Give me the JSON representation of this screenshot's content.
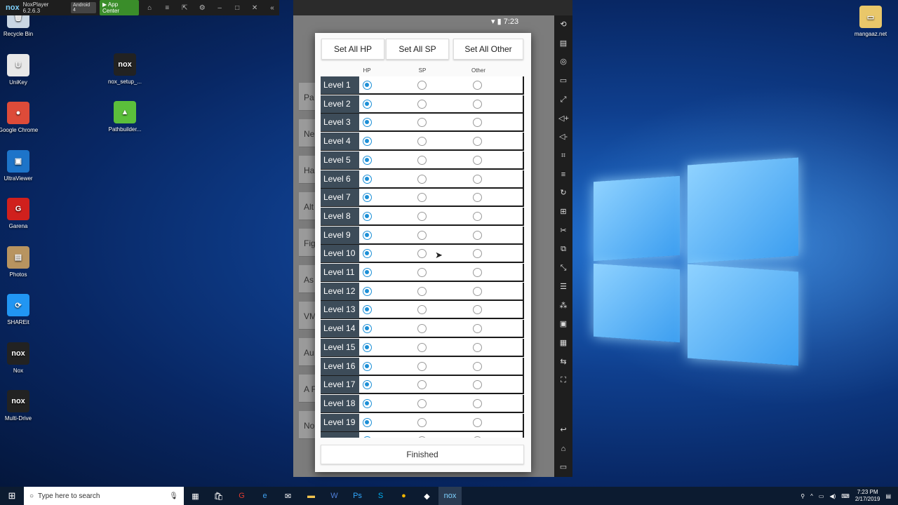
{
  "desktop": {
    "icons": [
      {
        "label": "Recycle Bin",
        "icon": "recycle-bin-icon",
        "color": "#c9d6e3",
        "glyph": "🗑"
      },
      {
        "label": "UniKey",
        "icon": "unikey-icon",
        "color": "#e8e8e8",
        "glyph": "U"
      },
      {
        "label": "Google Chrome",
        "icon": "chrome-icon",
        "color": "#dd4b39",
        "glyph": "●"
      },
      {
        "label": "UltraViewer",
        "icon": "ultraviewer-icon",
        "color": "#1d74c9",
        "glyph": "▣"
      },
      {
        "label": "Garena",
        "icon": "garena-icon",
        "color": "#d0201d",
        "glyph": "G"
      },
      {
        "label": "Photos",
        "icon": "photos-icon",
        "color": "#b89460",
        "glyph": "▤"
      },
      {
        "label": "SHAREit",
        "icon": "shareit-icon",
        "color": "#2196f3",
        "glyph": "⟳"
      },
      {
        "label": "Nox",
        "icon": "nox-icon",
        "color": "#222",
        "glyph": "nox"
      },
      {
        "label": "Multi-Drive",
        "icon": "multi-drive-icon",
        "color": "#222",
        "glyph": "nox"
      }
    ],
    "icons2": [
      {
        "label": "nox_setup_...",
        "icon": "nox-setup-icon",
        "color": "#222",
        "glyph": "nox"
      },
      {
        "label": "Pathbuilder...",
        "icon": "pathbuilder-icon",
        "color": "#5bbf3b",
        "glyph": "▲"
      }
    ],
    "folder": {
      "label": "mangaaz.net",
      "icon": "folder-icon"
    }
  },
  "nox": {
    "title": "NoxPlayer 6.2.6.3",
    "logo": "nox",
    "android": "Android 4",
    "app_center": "App Center",
    "time": "7:23"
  },
  "dialog": {
    "btn_hp": "Set All HP",
    "btn_sp": "Set All SP",
    "btn_other": "Set All Other",
    "col_hp": "HP",
    "col_sp": "SP",
    "col_other": "Other",
    "finish": "Finished",
    "accent": "#1c8fd6",
    "levels": [
      {
        "label": "Level 1",
        "selected": "HP"
      },
      {
        "label": "Level 2",
        "selected": "HP"
      },
      {
        "label": "Level 3",
        "selected": "HP"
      },
      {
        "label": "Level 4",
        "selected": "HP"
      },
      {
        "label": "Level 5",
        "selected": "HP"
      },
      {
        "label": "Level 6",
        "selected": "HP"
      },
      {
        "label": "Level 7",
        "selected": "HP"
      },
      {
        "label": "Level 8",
        "selected": "HP"
      },
      {
        "label": "Level 9",
        "selected": "HP"
      },
      {
        "label": "Level 10",
        "selected": "HP"
      },
      {
        "label": "Level 11",
        "selected": "HP"
      },
      {
        "label": "Level 12",
        "selected": "HP"
      },
      {
        "label": "Level 13",
        "selected": "HP"
      },
      {
        "label": "Level 14",
        "selected": "HP"
      },
      {
        "label": "Level 15",
        "selected": "HP"
      },
      {
        "label": "Level 16",
        "selected": "HP"
      },
      {
        "label": "Level 17",
        "selected": "HP"
      },
      {
        "label": "Level 18",
        "selected": "HP"
      },
      {
        "label": "Level 19",
        "selected": "HP"
      },
      {
        "label": "",
        "selected": "HP"
      }
    ]
  },
  "background_cards": [
    "Pa",
    "Ne",
    "Ha",
    "Alt",
    "Fig",
    "As",
    "VM",
    "Au",
    "A F",
    "No"
  ],
  "taskbar": {
    "search_placeholder": "Type here to search",
    "time": "7:23 PM",
    "date": "2/17/2019"
  }
}
